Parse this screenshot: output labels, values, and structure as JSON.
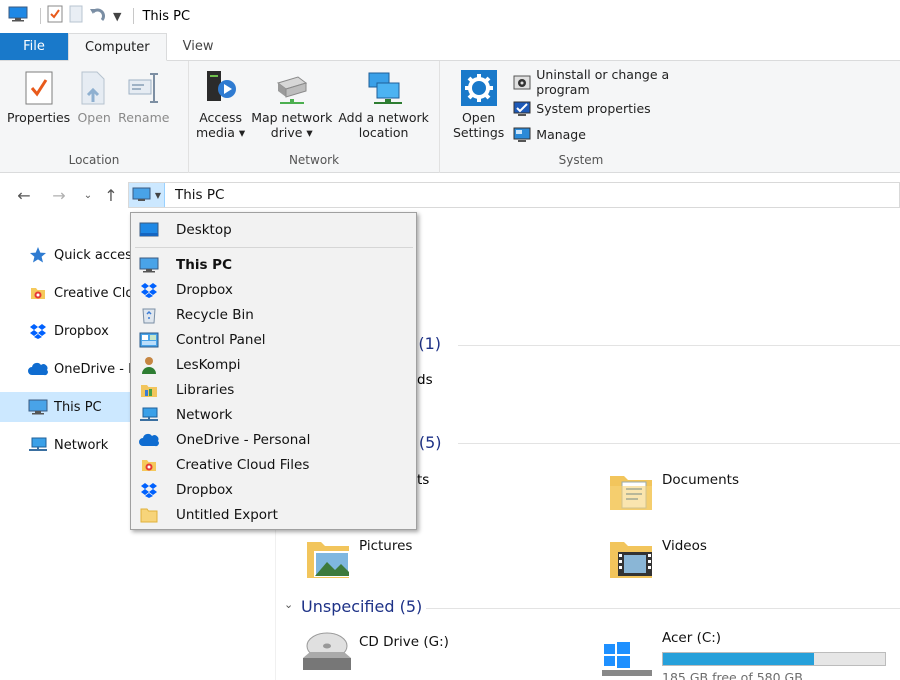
{
  "window": {
    "title": "This PC"
  },
  "tabs": {
    "file": "File",
    "computer": "Computer",
    "view": "View"
  },
  "ribbon": {
    "location": {
      "label": "Location",
      "properties": "Properties",
      "open": "Open",
      "rename": "Rename"
    },
    "network": {
      "label": "Network",
      "access_media": [
        "Access",
        "media ▾"
      ],
      "map_drive": [
        "Map network",
        "drive ▾"
      ],
      "add_location": [
        "Add a network",
        "location"
      ]
    },
    "system": {
      "label": "System",
      "open_settings": [
        "Open",
        "Settings"
      ],
      "uninstall": "Uninstall or change a program",
      "system_properties": "System properties",
      "manage": "Manage"
    }
  },
  "address": {
    "path": "This PC"
  },
  "nav_pane": [
    {
      "label": "Quick access",
      "icon": "star-icon"
    },
    {
      "label": "Creative Cloud Files",
      "icon": "creative-cloud-icon"
    },
    {
      "label": "Dropbox",
      "icon": "dropbox-icon"
    },
    {
      "label": "OneDrive - Personal",
      "icon": "onedrive-icon"
    },
    {
      "label": "This PC",
      "icon": "computer-icon"
    },
    {
      "label": "Network",
      "icon": "network-icon"
    }
  ],
  "dropdown": [
    {
      "label": "Desktop",
      "icon": "desktop-icon"
    },
    {
      "label": "This PC",
      "icon": "computer-icon"
    },
    {
      "label": "Dropbox",
      "icon": "dropbox-icon"
    },
    {
      "label": "Recycle Bin",
      "icon": "recycle-bin-icon"
    },
    {
      "label": "Control Panel",
      "icon": "control-panel-icon"
    },
    {
      "label": "LesKompi",
      "icon": "user-icon"
    },
    {
      "label": "Libraries",
      "icon": "libraries-icon"
    },
    {
      "label": "Network",
      "icon": "network-icon"
    },
    {
      "label": "OneDrive - Personal",
      "icon": "onedrive-icon"
    },
    {
      "label": "Creative Cloud Files",
      "icon": "creative-cloud-icon"
    },
    {
      "label": "Dropbox",
      "icon": "dropbox-icon"
    },
    {
      "label": "Untitled Export",
      "icon": "folder-icon"
    }
  ],
  "content": {
    "sec1_partial": "k (1)",
    "sec1_item_partial": "ds",
    "sec2_partial": "o (5)",
    "sec2_item_partial": "ts",
    "folders": {
      "documents": "Documents",
      "pictures": "Pictures",
      "videos": "Videos"
    },
    "unspecified": "Unspecified (5)",
    "drives": {
      "cd": "CD Drive (G:)",
      "acer": "Acer (C:)",
      "acer_free": "185 GB free of 580 GB",
      "acer_used_fraction": 0.68
    }
  },
  "colors": {
    "accent": "#1979ca",
    "selection": "#cce8ff",
    "header": "#1e3287",
    "drivebar": "#26a0da"
  }
}
